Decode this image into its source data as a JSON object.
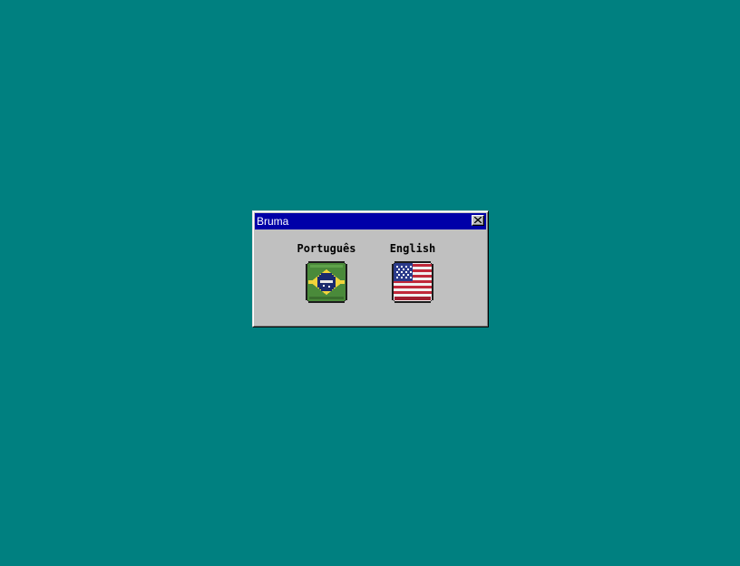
{
  "window": {
    "title": "Bruma",
    "close_icon": "close-icon"
  },
  "languages": [
    {
      "label": "Português",
      "icon": "brazil-flag-icon"
    },
    {
      "label": "English",
      "icon": "usa-flag-icon"
    }
  ],
  "colors": {
    "desktop": "#008080",
    "titlebar": "#0000a8",
    "window_face": "#c0c0c0"
  }
}
